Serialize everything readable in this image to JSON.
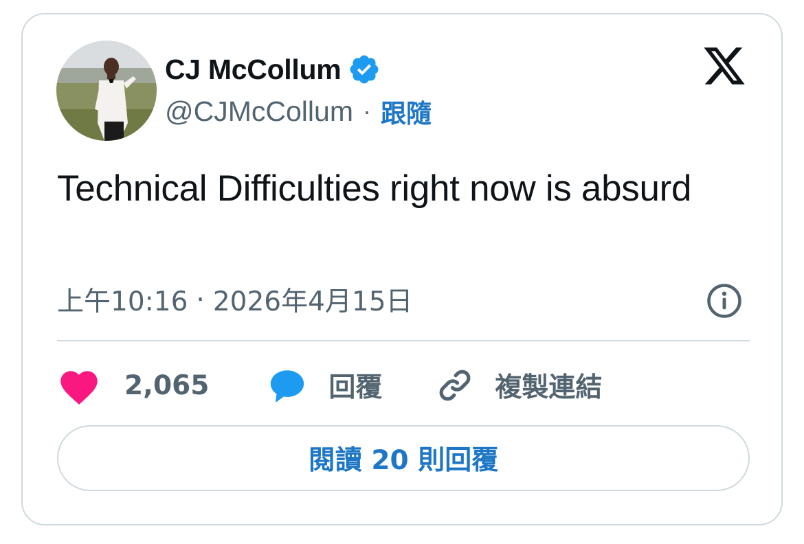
{
  "author": {
    "display_name": "CJ McCollum",
    "handle": "@CJMcCollum",
    "verified": true,
    "follow_label": "跟隨"
  },
  "tweet": {
    "text": "Technical Difficulties right now is absurd",
    "time": "上午10:16",
    "separator": "·",
    "date": "2026年4月15日"
  },
  "actions": {
    "like_count": "2,065",
    "reply_label": "回覆",
    "copy_link_label": "複製連結"
  },
  "read_replies_label": "閱讀 20 則回覆",
  "icons": {
    "platform_logo": "x-logo-icon",
    "verified": "verified-badge-icon",
    "info": "info-icon",
    "like": "heart-icon",
    "reply": "speech-bubble-icon",
    "copy": "link-icon"
  },
  "colors": {
    "text_primary": "#0f1419",
    "text_secondary": "#536471",
    "link_blue": "#1d76c6",
    "verified_blue": "#1d9bf0",
    "like_pink": "#f91880",
    "reply_blue": "#1d9bf0",
    "border": "#cfd9de"
  }
}
